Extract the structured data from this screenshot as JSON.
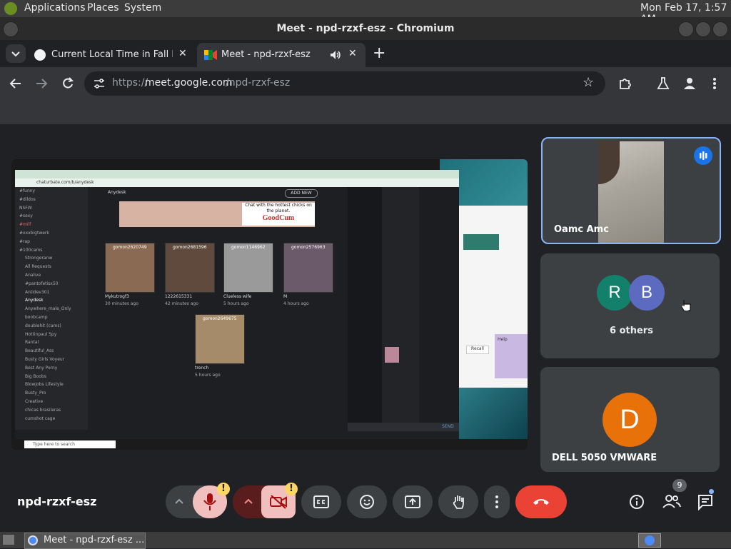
{
  "gnome": {
    "menus": [
      "Applications",
      "Places",
      "System"
    ],
    "clock": "Mon Feb 17,  1:57 AM"
  },
  "window": {
    "title": "Meet - npd-rzxf-esz - Chromium"
  },
  "tabs": [
    {
      "label": "Current Local Time in Fall Riv",
      "icon": "clock-favicon"
    },
    {
      "label": "Meet - npd-rzxf-esz",
      "icon": "meet-favicon"
    }
  ],
  "address": {
    "prefix": "https://",
    "host": "meet.google.com",
    "path": "/npd-rzxf-esz"
  },
  "meeting": {
    "code": "npd-rzxf-esz",
    "participants_count": "9"
  },
  "tiles": [
    {
      "name": "Oamc Amc",
      "speaking": true
    },
    {
      "avatars": [
        "R",
        "B"
      ],
      "avatar_colors": [
        "#12806a",
        "#5c6bc0"
      ],
      "label": "6 others"
    },
    {
      "name": "DELL 5050 VMWARE",
      "avatar": "D",
      "avatar_color": "#e8710a"
    }
  ],
  "shared": {
    "url": "chaturbate.com/b/anydesk",
    "channel": "Anydesk",
    "ad_text": "Chat with the hottest chicks on the planet.",
    "ad_brand": "GoodCum",
    "add_new": "ADD NEW",
    "cards": [
      {
        "user": "gomon2620749",
        "label": "Mykutrogf3",
        "time": "30 minutes ago"
      },
      {
        "user": "gomon2681596",
        "label": "1222615331",
        "time": "42 minutes ago"
      },
      {
        "user": "gomon1146962",
        "label": "Clueless wife",
        "time": "5 hours ago"
      },
      {
        "user": "gomon2576963",
        "label": "M",
        "time": "4 hours ago"
      },
      {
        "user": "gomon2649675",
        "label": "trench",
        "time": "5 hours ago"
      }
    ],
    "sidebar": [
      "#funny",
      "#dildos",
      "NSFW",
      "#sexy",
      "#milf",
      "#xxxbigtwerk",
      "#rap",
      "#100cams",
      "Strongeranw",
      "All Requests",
      "Analive",
      "#pantofetisx50",
      "Antidev301",
      "Anydesk",
      "Anywhere_male_Only",
      "boobcamp",
      "doublehit (cams)",
      "Hottinpaul Spy",
      "Rantal",
      "Beautiful_Ass",
      "Busty Girls Voyeur",
      "Best Any Porny",
      "Big Boobs",
      "Blowjobs Lifestyle",
      "Busty_Pro",
      "Creative",
      "chicas brasileras",
      "cumshot cage"
    ],
    "send": "SEND",
    "search": "Type here to search",
    "recall": "Recall",
    "help": "Help"
  },
  "taskbar": {
    "window": "Meet - npd-rzxf-esz ..."
  }
}
